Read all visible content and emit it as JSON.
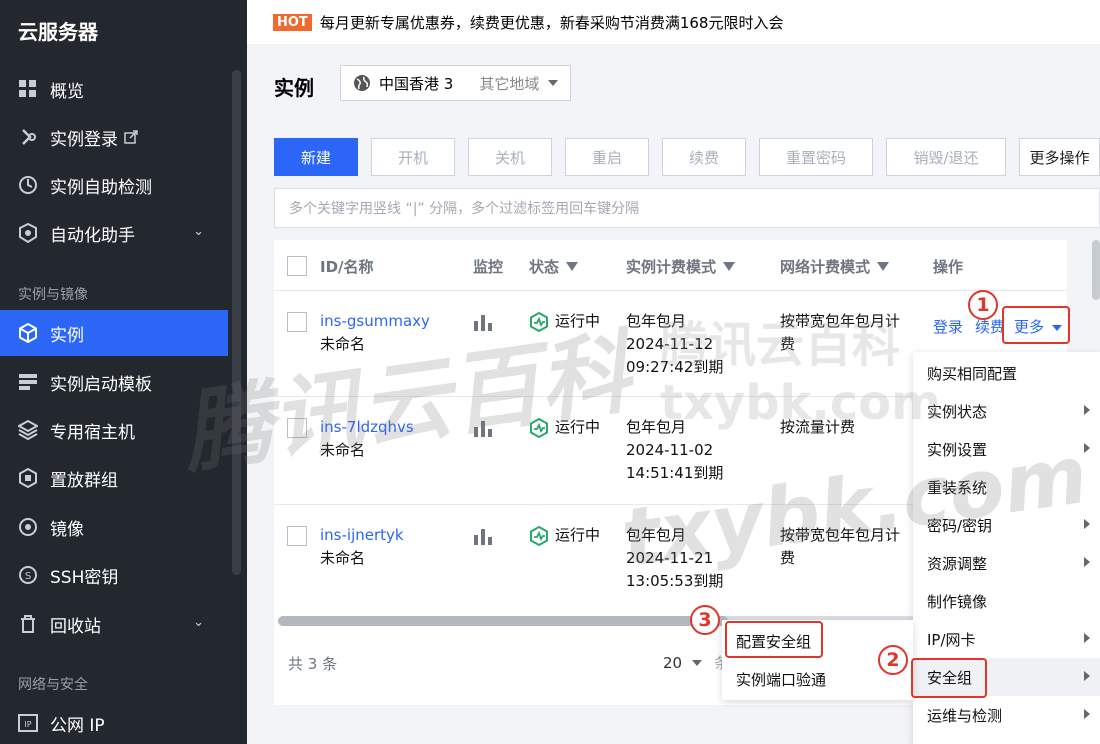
{
  "sidebar": {
    "title": "云服务器",
    "items": [
      {
        "label": "概览",
        "icon": "grid-icon"
      },
      {
        "label": "实例登录",
        "icon": "login-icon"
      },
      {
        "label": "实例自助检测",
        "icon": "detect-icon"
      },
      {
        "label": "自动化助手",
        "icon": "automation-icon"
      },
      {
        "label": "实例",
        "icon": "instance-icon"
      },
      {
        "label": "实例启动模板",
        "icon": "template-icon"
      },
      {
        "label": "专用宿主机",
        "icon": "host-icon"
      },
      {
        "label": "置放群组",
        "icon": "placement-icon"
      },
      {
        "label": "镜像",
        "icon": "image-icon"
      },
      {
        "label": "SSH密钥",
        "icon": "ssh-key-icon"
      },
      {
        "label": "回收站",
        "icon": "recycle-icon"
      },
      {
        "label": "公网 IP",
        "icon": "ip-icon"
      }
    ],
    "groups": [
      "实例与镜像",
      "网络与安全"
    ]
  },
  "banner": {
    "badge": "HOT",
    "text": "每月更新专属优惠券，续费更优惠，新春采购节消费满168元限时入会"
  },
  "page": {
    "title": "实例",
    "region": "中国香港 3",
    "other_region": "其它地域"
  },
  "toolbar": {
    "new": "新建",
    "start": "开机",
    "stop": "关机",
    "restart": "重启",
    "renew": "续费",
    "reset_password": "重置密码",
    "destroy": "销毁/退还",
    "more_ops": "更多操作"
  },
  "search": {
    "placeholder": "多个关键字用竖线 “|” 分隔，多个过滤标签用回车键分隔"
  },
  "table": {
    "headers": {
      "id": "ID/名称",
      "monitor": "监控",
      "status": "状态",
      "billing": "实例计费模式",
      "net_billing": "网络计费模式",
      "ops": "操作"
    },
    "rows": [
      {
        "id": "ins-gsummaxy",
        "name": "未命名",
        "status": "运行中",
        "billing": "包年包月",
        "date": "2024-11-12",
        "time": "09:27:42到期",
        "net1": "按带宽包年包月计",
        "net2": "费"
      },
      {
        "id": "ins-7ldzqhvs",
        "name": "未命名",
        "status": "运行中",
        "billing": "包年包月",
        "date": "2024-11-02",
        "time": "14:51:41到期",
        "net1": "按流量计费",
        "net2": ""
      },
      {
        "id": "ins-ijnertyk",
        "name": "未命名",
        "status": "运行中",
        "billing": "包年包月",
        "date": "2024-11-21",
        "time": "13:05:53到期",
        "net1": "按带宽包年包月计",
        "net2": "费"
      }
    ],
    "row_actions": {
      "login": "登录",
      "renew": "续费",
      "more": "更多"
    },
    "total": "共 3 条",
    "page_size": "20",
    "page_size_unit": "条"
  },
  "more_menu": [
    "购买相同配置",
    "实例状态",
    "实例设置",
    "重装系统",
    "密码/密钥",
    "资源调整",
    "制作镜像",
    "IP/网卡",
    "安全组",
    "运维与检测"
  ],
  "security_submenu": [
    "配置安全组",
    "实例端口验通"
  ],
  "annotations": [
    "1",
    "2",
    "3"
  ],
  "watermarks": [
    "腾讯云百科",
    "txybk.com",
    "腾讯云百科 txybk.com"
  ]
}
